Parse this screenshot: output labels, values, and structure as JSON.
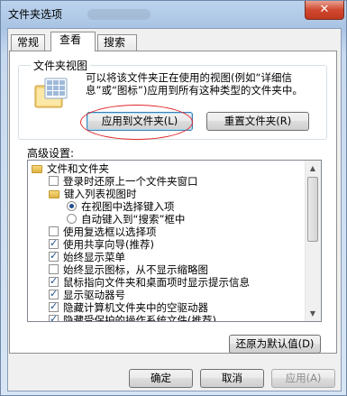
{
  "window": {
    "title": "文件夹选项",
    "close_icon": "✕"
  },
  "tabs": [
    {
      "label": "常规"
    },
    {
      "label": "查看"
    },
    {
      "label": "搜索"
    }
  ],
  "folder_views": {
    "title": "文件夹视图",
    "description": "可以将该文件夹正在使用的视图(例如“详细信息”或“图标”)应用到所有这种类型的文件夹中。",
    "apply_button": "应用到文件夹(L)",
    "reset_button": "重置文件夹(R)"
  },
  "advanced": {
    "label": "高级设置:",
    "items": [
      {
        "type": "folder",
        "label": "文件和文件夹"
      },
      {
        "type": "checkbox",
        "checked": false,
        "label": "登录时还原上一个文件夹窗口"
      },
      {
        "type": "folder",
        "label": "键入列表视图时"
      },
      {
        "type": "radio",
        "checked": true,
        "label": "在视图中选择键入项"
      },
      {
        "type": "radio",
        "checked": false,
        "label": "自动键入到“搜索”框中"
      },
      {
        "type": "checkbox",
        "checked": false,
        "label": "使用复选框以选择项"
      },
      {
        "type": "checkbox",
        "checked": true,
        "label": "使用共享向导(推荐)"
      },
      {
        "type": "checkbox",
        "checked": true,
        "label": "始终显示菜单"
      },
      {
        "type": "checkbox",
        "checked": false,
        "label": "始终显示图标，从不显示缩略图"
      },
      {
        "type": "checkbox",
        "checked": true,
        "label": "鼠标指向文件夹和桌面项时显示提示信息"
      },
      {
        "type": "checkbox",
        "checked": true,
        "label": "显示驱动器号"
      },
      {
        "type": "checkbox",
        "checked": true,
        "label": "隐藏计算机文件夹中的空驱动器"
      },
      {
        "type": "checkbox",
        "checked": true,
        "label": "隐藏受保护的操作系统文件(推荐)"
      }
    ],
    "restore_defaults_button": "还原为默认值(D)"
  },
  "footer": {
    "ok": "确定",
    "cancel": "取消",
    "apply": "应用(A)"
  },
  "colors": {
    "highlight_ring": "#e0262a",
    "title_bar": "#bcd3ec"
  }
}
